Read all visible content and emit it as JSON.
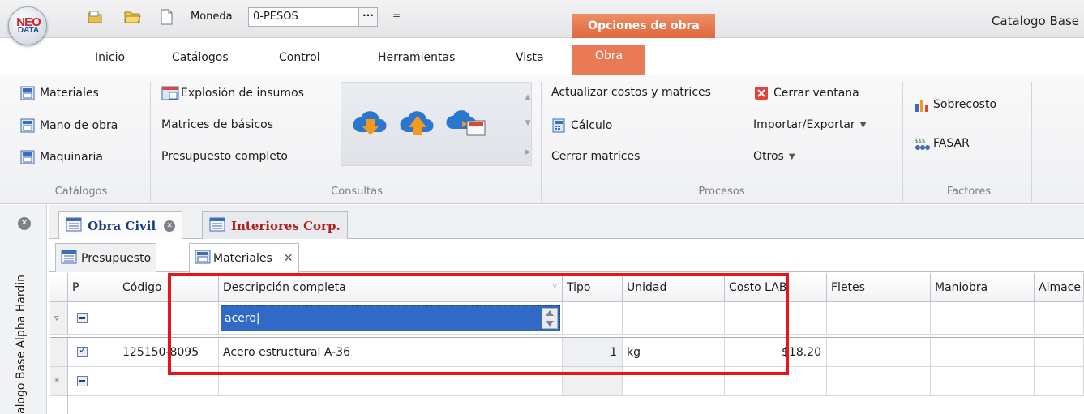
{
  "app": {
    "logo_top": "NEO",
    "logo_bottom": "DATA",
    "title": "Catalogo Base"
  },
  "quick_access": {
    "moneda_label": "Moneda",
    "moneda_value": "0-PESOS",
    "moneda_button": "···",
    "more": "=",
    "icons": [
      "open-folder-icon",
      "folder-icon",
      "new-document-icon"
    ]
  },
  "context_tab_header": "Opciones de obra",
  "menu": {
    "tabs": [
      "Inicio",
      "Catálogos",
      "Control",
      "Herramientas",
      "Vista",
      "Obra"
    ],
    "active": "Obra"
  },
  "ribbon": {
    "catalogos": {
      "label": "Catálogos",
      "items": [
        "Materiales",
        "Mano de obra",
        "Maquinaria"
      ]
    },
    "consultas": {
      "label": "Consultas",
      "items": [
        "Explosión de insumos",
        "Matrices de básicos",
        "Presupuesto completo"
      ]
    },
    "procesos": {
      "label": "Procesos",
      "items": [
        "Actualizar costos y matrices",
        "Cálculo",
        "Cerrar matrices",
        "Cerrar ventana",
        "Importar/Exportar",
        "Otros"
      ]
    },
    "factores": {
      "label": "Factores",
      "items": [
        "Sobrecosto",
        "FASAR"
      ]
    }
  },
  "side_panel": {
    "vertical_label": "alogo Base Alpha Hardin"
  },
  "document_tabs": [
    {
      "label": "Obra Civil",
      "active": true
    },
    {
      "label": "Interiores Corp.",
      "active": false
    }
  ],
  "sub_tabs": [
    {
      "label": "Presupuesto",
      "active": false
    },
    {
      "label": "Materiales",
      "active": true
    }
  ],
  "grid": {
    "columns": [
      "P",
      "Código",
      "Descripción completa",
      "Tipo",
      "Unidad",
      "Costo LAB",
      "Fletes",
      "Maniobra",
      "Almace"
    ],
    "filter_row": {
      "descripcion": "acero"
    },
    "rows": [
      {
        "checked": true,
        "codigo": "125150-8095",
        "descripcion": "Acero estructural A-36",
        "tipo": "1",
        "unidad": "kg",
        "costo": "$18.20",
        "fletes": "",
        "maniobra": "",
        "almace": ""
      }
    ]
  }
}
